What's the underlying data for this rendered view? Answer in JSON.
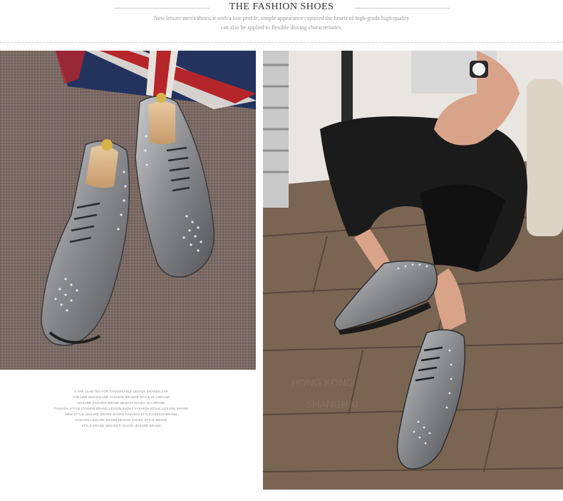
{
  "header": {
    "title": "THE FASHION SHOES",
    "subtitle_line1": "New leisure men's shoes, it with a low profile, simple appearance captured the hearts of high-grade high-quality",
    "subtitle_line2": "can also be applied to flexible driving characteristics."
  },
  "caption": {
    "lines": [
      "A THE LEAN TEA FOR FASHIONABLE DESIGN BRANDS CAP",
      "THE LINE DESIGN AND FASHION BRANDS STYLE IN A BRAND",
      "LEISURE FASHION BRAND DESIGN SHOES IN A BRAND",
      "FASHION STYLE LEISURE BRAND DESIGN SHOES FASHION STYLE LEISURE BRAND",
      "NEW STYLE LEISURE BRAND SHOES FASHION STYLE DESIGN BRAND",
      "FASHION LEISURE BRAND DESIGN SHOES STYLE BRAND",
      "STYLE BRAND DESIGN FASHION LEISURE BRAND"
    ]
  },
  "photos": {
    "left": "grey-patent-oxford-shoes-on-carpet-photo",
    "right": "man-wearing-grey-patent-oxford-shoes-on-wood-floor-photo"
  },
  "colors": {
    "shoe": "#8b8d90",
    "carpet": "#7d6a64",
    "floor": "#6d5d52",
    "trousers": "#1b1b1b"
  }
}
